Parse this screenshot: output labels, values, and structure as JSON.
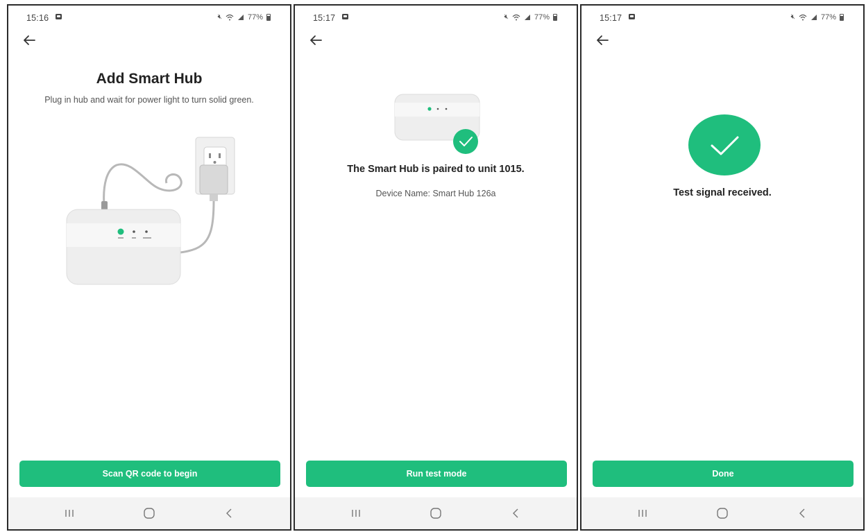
{
  "theme": {
    "accent": "#1fbe7d",
    "text": "#222222",
    "muted": "#555555",
    "navbar_bg": "#f3f3f3"
  },
  "screens": [
    {
      "status": {
        "time": "15:16",
        "battery": "77%",
        "icons": [
          "notification-icon",
          "mute-icon",
          "wifi-icon",
          "signal-icon",
          "battery-icon"
        ]
      },
      "title": "Add Smart Hub",
      "subtitle": "Plug in hub and wait for power light to turn solid green.",
      "button": "Scan QR code to begin",
      "nav": {
        "recent": "III",
        "home": "home-circle-icon",
        "back": "<"
      }
    },
    {
      "status": {
        "time": "15:17",
        "battery": "77%"
      },
      "heading": "The Smart Hub is paired to unit 1015.",
      "device_name": "Device Name: Smart Hub 126a",
      "button": "Run test mode",
      "nav": {
        "recent": "III",
        "home": "home-circle-icon",
        "back": "<"
      }
    },
    {
      "status": {
        "time": "15:17",
        "battery": "77%"
      },
      "heading": "Test signal received.",
      "button": "Done",
      "nav": {
        "recent": "III",
        "home": "home-circle-icon",
        "back": "<"
      }
    }
  ]
}
